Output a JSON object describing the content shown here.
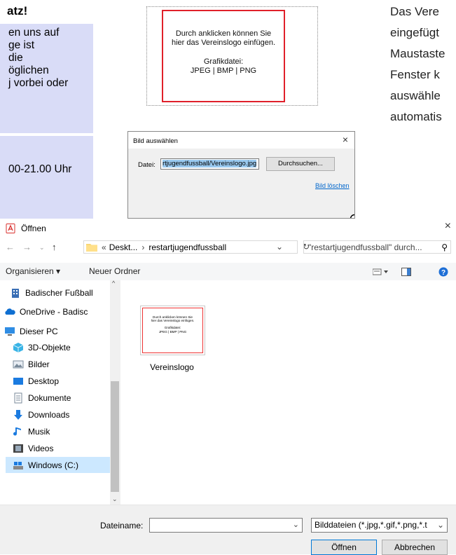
{
  "left_panel": {
    "title": "atz!",
    "lines1": [
      "en uns auf",
      "ge ist",
      "die",
      "öglichen",
      "j vorbei oder"
    ],
    "lines2": [
      "00-21.00 Uhr"
    ]
  },
  "logo_placeholder": {
    "line1": "Durch anklicken können Sie",
    "line2": "hier das Vereinslogo einfügen.",
    "line3": "Grafikdatei:",
    "line4": "JPEG | BMP | PNG"
  },
  "right_paragraph": [
    "Das Vere",
    "eingefügt",
    "Maustaste",
    "Fenster k",
    "auswähle",
    "automatis"
  ],
  "bild_dialog": {
    "title": "Bild auswählen",
    "close": "×",
    "file_label": "Datei:",
    "file_value": "rtjugendfussball/Vereinslogo.jpg",
    "browse": "Durchsuchen...",
    "delete_link": "Bild löschen"
  },
  "open_dialog": {
    "title": "Öffnen",
    "close": "×",
    "path": {
      "prefix": "«",
      "seg1": "Deskt...",
      "sep": "›",
      "seg2": "restartjugendfussball"
    },
    "search_placeholder": "\"restartjugendfussball\" durch...",
    "toolbar": {
      "organize": "Organisieren ▾",
      "new_folder": "Neuer Ordner"
    },
    "nav": [
      "Badischer Fußball",
      "OneDrive - Badisc",
      "Dieser PC",
      "3D-Objekte",
      "Bilder",
      "Desktop",
      "Dokumente",
      "Downloads",
      "Musik",
      "Videos",
      "Windows (C:)"
    ],
    "file": {
      "name": "Vereinslogo",
      "thumb_line1": "Durch anklicken können Sie",
      "thumb_line2": "hier das Vereinslogo einfügen.",
      "thumb_line3": "Grafikdatei:",
      "thumb_line4": "JPEG | BMP | PNG"
    },
    "filename_label": "Dateiname:",
    "filter": "Bilddateien (*.jpg,*.gif,*.png,*.t",
    "open_btn": "Öffnen",
    "cancel_btn": "Abbrechen"
  },
  "colors": {
    "panel": "#d9dcf7",
    "logo_border": "#e0202a",
    "selection": "#cce8ff",
    "link": "#0066cc"
  }
}
